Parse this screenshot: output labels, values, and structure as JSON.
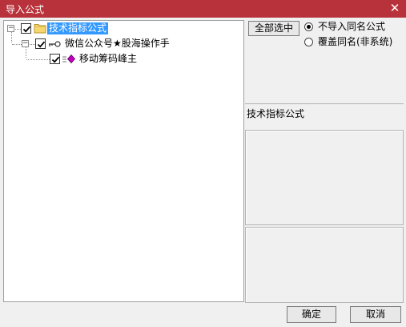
{
  "window": {
    "title": "导入公式",
    "close_glyph": "✕"
  },
  "tree": {
    "root": {
      "label": "技术指标公式",
      "checked": true,
      "expander": "−"
    },
    "group": {
      "label": "微信公众号★股海操作手",
      "checked": true,
      "expander": "−"
    },
    "leaf": {
      "label": "移动筹码峰主",
      "checked": true
    }
  },
  "options": {
    "select_all_label": "全部选中",
    "radio_skip_label": "不导入同名公式",
    "radio_overwrite_label": "覆盖同名(非系统)",
    "selected": "skip"
  },
  "info": {
    "category_label": "技术指标公式"
  },
  "footer": {
    "ok_label": "确定",
    "cancel_label": "取消"
  }
}
